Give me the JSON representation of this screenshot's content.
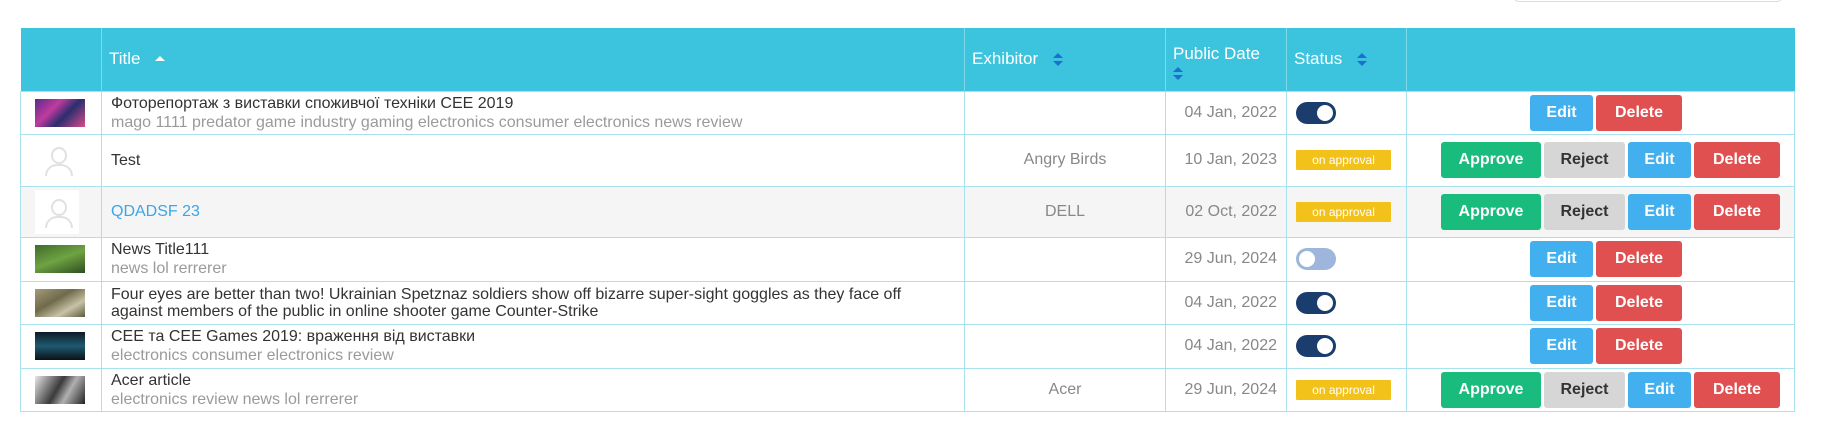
{
  "header": {
    "title": "Title",
    "exhibitor": "Exhibitor",
    "public_date": "Public Date",
    "status": "Status"
  },
  "buttons": {
    "approve": "Approve",
    "reject": "Reject",
    "edit": "Edit",
    "delete": "Delete"
  },
  "rows": [
    {
      "title": "Фоторепортаж з виставки споживчої техніки CEE 2019",
      "subtitle": "mago 1111 predator game industry gaming electronics consumer electronics news review",
      "exhibitor": "",
      "date": "04 Jan, 2022",
      "status": "published",
      "toggle_on": true,
      "thumbnail": "photo-expo-icon"
    },
    {
      "title": "Test",
      "subtitle": "",
      "exhibitor": "Angry Birds",
      "date": "10 Jan, 2023",
      "status": "on approval",
      "thumbnail": "user-placeholder-icon"
    },
    {
      "title": "QDADSF 23",
      "subtitle": "",
      "exhibitor": "DELL",
      "date": "02 Oct, 2022",
      "status": "on approval",
      "thumbnail": "user-placeholder-icon"
    },
    {
      "title": "News Title111",
      "subtitle": "news lol rerrerer",
      "exhibitor": "",
      "date": "29 Jun, 2024",
      "status": "unpublished",
      "toggle_on": false,
      "thumbnail": "photo-nature-icon"
    },
    {
      "title": "Four eyes are better than two! Ukrainian Spetznaz soldiers show off bizarre super-sight goggles as they face off against members of the public in online shooter game Counter-Strike",
      "subtitle": "",
      "exhibitor": "",
      "date": "04 Jan, 2022",
      "status": "published",
      "toggle_on": true,
      "thumbnail": "photo-soldiers-icon"
    },
    {
      "title": "CEE та CEE Games 2019: враження від виставки",
      "subtitle": "electronics consumer electronics review",
      "exhibitor": "",
      "date": "04 Jan, 2022",
      "status": "published",
      "toggle_on": true,
      "thumbnail": "photo-stage-icon"
    },
    {
      "title": "Acer article",
      "subtitle": "electronics review news lol rerrerer",
      "exhibitor": "Acer",
      "date": "29 Jun, 2024",
      "status": "on approval",
      "thumbnail": "photo-person-icon"
    }
  ],
  "colors": {
    "header_bg": "#3cc4df",
    "approve": "#1abc7e",
    "reject": "#d6d6d6",
    "edit": "#42b0ee",
    "delete": "#e05050",
    "badge": "#f3c21a",
    "toggle_on": "#1b3d6d",
    "toggle_off": "#9eb6dc"
  }
}
